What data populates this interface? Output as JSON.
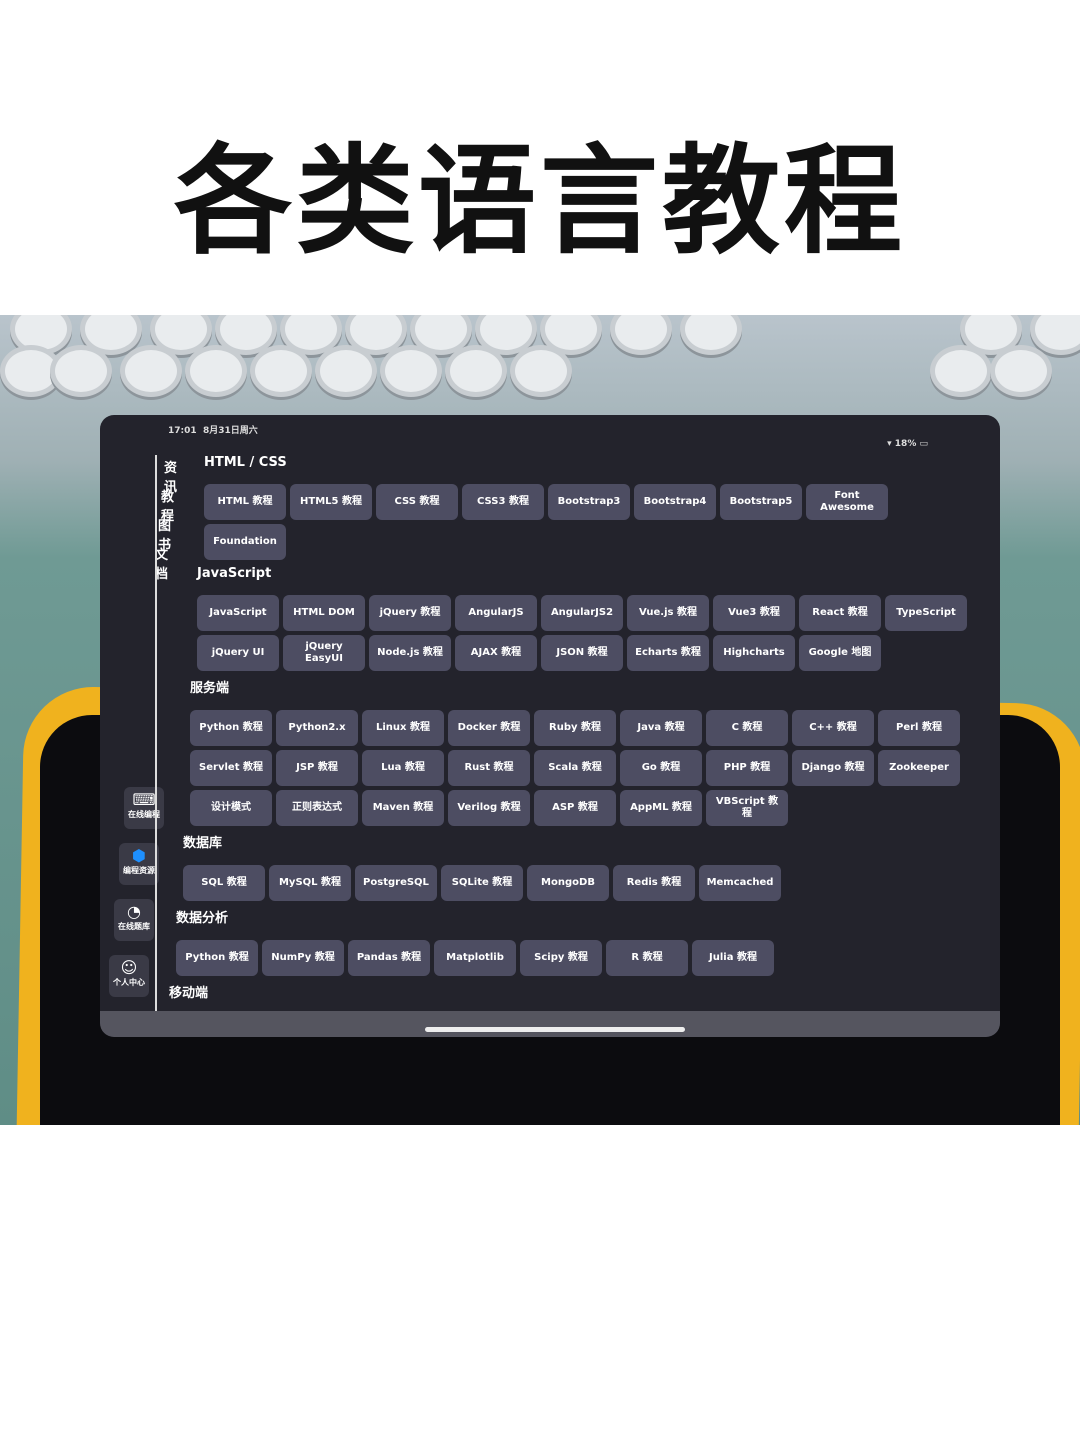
{
  "headline": "各类语言教程",
  "status": {
    "time": "17:01",
    "date": "8月31日周六",
    "battery": "18%"
  },
  "sidebar": {
    "tabs": [
      "资讯",
      "教程",
      "图书",
      "文档"
    ],
    "bottom": [
      {
        "icon": "code-monitor-icon",
        "label": "在线编程"
      },
      {
        "icon": "shield-icon",
        "label": "编程资源"
      },
      {
        "icon": "chart-icon",
        "label": "在线题库"
      },
      {
        "icon": "user-icon",
        "label": "个人中心"
      }
    ]
  },
  "sections": [
    {
      "title": "HTML / CSS",
      "items": [
        "HTML 教程",
        "HTML5 教程",
        "CSS 教程",
        "CSS3 教程",
        "Bootstrap3",
        "Bootstrap4",
        "Bootstrap5",
        "Font Awesome",
        "Foundation"
      ]
    },
    {
      "title": "JavaScript",
      "items": [
        "JavaScript",
        "HTML DOM",
        "jQuery 教程",
        "AngularJS",
        "AngularJS2",
        "Vue.js 教程",
        "Vue3 教程",
        "React 教程",
        "TypeScript",
        "jQuery UI",
        "jQuery EasyUI",
        "Node.js 教程",
        "AJAX 教程",
        "JSON 教程",
        "Echarts 教程",
        "Highcharts",
        "Google 地图"
      ]
    },
    {
      "title": "服务端",
      "items": [
        "Python 教程",
        "Python2.x",
        "Linux 教程",
        "Docker 教程",
        "Ruby 教程",
        "Java 教程",
        "C 教程",
        "C++ 教程",
        "Perl 教程",
        "Servlet 教程",
        "JSP 教程",
        "Lua 教程",
        "Rust 教程",
        "Scala 教程",
        "Go 教程",
        "PHP 教程",
        "Django 教程",
        "Zookeeper",
        "设计模式",
        "正则表达式",
        "Maven 教程",
        "Verilog 教程",
        "ASP 教程",
        "AppML 教程",
        "VBScript 教程"
      ]
    },
    {
      "title": "数据库",
      "items": [
        "SQL 教程",
        "MySQL 教程",
        "PostgreSQL",
        "SQLite 教程",
        "MongoDB",
        "Redis 教程",
        "Memcached"
      ]
    },
    {
      "title": "数据分析",
      "items": [
        "Python 教程",
        "NumPy 教程",
        "Pandas 教程",
        "Matplotlib",
        "Scipy 教程",
        "R 教程",
        "Julia 教程"
      ]
    },
    {
      "title": "移动端",
      "items": []
    }
  ]
}
